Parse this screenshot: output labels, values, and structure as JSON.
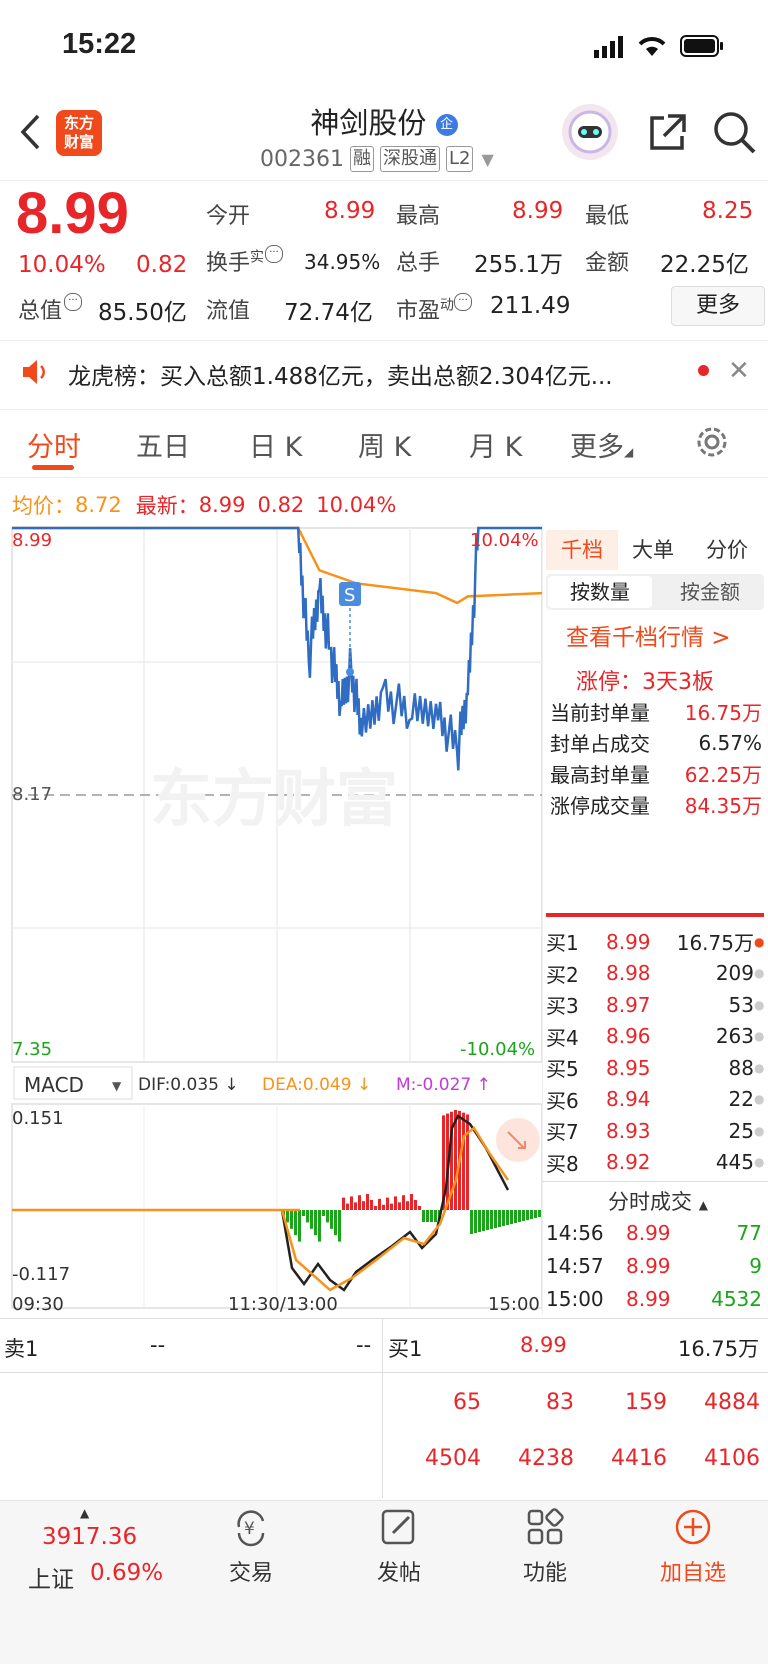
{
  "status": {
    "time": "15:22"
  },
  "header": {
    "logo_text": "东方\n财富",
    "name": "神剑股份",
    "name_badge": "企",
    "code": "002361",
    "tags": [
      "融",
      "深股通",
      "L2"
    ]
  },
  "quote": {
    "price": "8.99",
    "change_pct": "10.04%",
    "change": "0.82",
    "open_label": "今开",
    "open": "8.99",
    "high_label": "最高",
    "high": "8.99",
    "low_label": "最低",
    "low": "8.25",
    "turnover_label": "换手",
    "turnover_sup": "实",
    "turnover": "34.95%",
    "volume_label": "总手",
    "volume": "255.1万",
    "amount_label": "金额",
    "amount": "22.25亿",
    "mktcap_label": "总值",
    "mktcap": "85.50亿",
    "float_label": "流值",
    "float": "72.74亿",
    "pe_label": "市盈",
    "pe_sup": "动",
    "pe": "211.49",
    "more_label": "更多"
  },
  "notice": {
    "text": "龙虎榜：买入总额1.488亿元，卖出总额2.304亿元..."
  },
  "tabs": [
    "分时",
    "五日",
    "日 K",
    "周 K",
    "月 K",
    "更多"
  ],
  "active_tab": "分时",
  "legend_line": {
    "avg_label": "均价：",
    "avg": "8.72",
    "last_label": "最新：",
    "last": "8.99",
    "chg": "0.82",
    "pct": "10.04%"
  },
  "chart_labels": {
    "y_top": "8.99",
    "y_mid": "8.17",
    "y_bot": "7.35",
    "pct_top": "10.04%",
    "pct_bot": "-10.04%",
    "watermark": "东方财富",
    "marker": "S",
    "macd_name": "MACD",
    "dif": "DIF:0.035 ↓",
    "dea": "DEA:0.049 ↓",
    "m": "M:-0.027 ↑",
    "macd_top": "0.151",
    "macd_bot": "-0.117",
    "t0": "09:30",
    "t1": "11:30/13:00",
    "t2": "15:00"
  },
  "colors": {
    "up": "#e8262a",
    "down": "#1aa51a",
    "avg": "#f7931a",
    "price": "#2f6cc2",
    "accent": "#f04a1c"
  },
  "chart_data": {
    "type": "line",
    "x": [
      "09:30",
      "11:30/13:00",
      "15:00"
    ],
    "ylim": [
      7.35,
      8.99
    ],
    "prev_close": 8.17,
    "series": [
      {
        "points": [
          [
            0,
            8.99
          ],
          [
            0.54,
            8.99
          ],
          [
            0.56,
            8.58
          ],
          [
            0.58,
            8.8
          ],
          [
            0.6,
            8.62
          ],
          [
            0.62,
            8.45
          ],
          [
            0.64,
            8.56
          ],
          [
            0.66,
            8.35
          ],
          [
            0.7,
            8.5
          ],
          [
            0.75,
            8.4
          ],
          [
            0.8,
            8.45
          ],
          [
            0.84,
            8.3
          ],
          [
            0.86,
            8.48
          ],
          [
            0.88,
            8.99
          ],
          [
            1.0,
            8.99
          ]
        ]
      },
      {
        "points": [
          [
            0,
            8.99
          ],
          [
            0.54,
            8.99
          ],
          [
            0.58,
            8.86
          ],
          [
            0.65,
            8.82
          ],
          [
            0.8,
            8.79
          ],
          [
            0.84,
            8.76
          ],
          [
            0.86,
            8.78
          ],
          [
            1.0,
            8.79
          ]
        ]
      }
    ]
  },
  "side": {
    "tabs": [
      "千档",
      "大单",
      "分价"
    ],
    "sub_tabs": [
      "按数量",
      "按金额"
    ],
    "link": "查看千档行情 >",
    "limit_title": "涨停：3天3板",
    "stats": [
      {
        "label": "当前封单量",
        "value": "16.75万"
      },
      {
        "label": "封单占成交",
        "value": "6.57%"
      },
      {
        "label": "最高封单量",
        "value": "62.25万"
      },
      {
        "label": "涨停成交量",
        "value": "84.35万"
      }
    ],
    "bids": [
      {
        "label": "买1",
        "price": "8.99",
        "vol": "16.75万"
      },
      {
        "label": "买2",
        "price": "8.98",
        "vol": "209"
      },
      {
        "label": "买3",
        "price": "8.97",
        "vol": "53"
      },
      {
        "label": "买4",
        "price": "8.96",
        "vol": "263"
      },
      {
        "label": "买5",
        "price": "8.95",
        "vol": "88"
      },
      {
        "label": "买6",
        "price": "8.94",
        "vol": "22"
      },
      {
        "label": "买7",
        "price": "8.93",
        "vol": "25"
      },
      {
        "label": "买8",
        "price": "8.92",
        "vol": "445"
      }
    ],
    "trades_title": "分时成交",
    "trades": [
      {
        "time": "14:56",
        "price": "8.99",
        "vol": "77"
      },
      {
        "time": "14:57",
        "price": "8.99",
        "vol": "9"
      },
      {
        "time": "15:00",
        "price": "8.99",
        "vol": "4532"
      }
    ]
  },
  "order_book": {
    "sell_label": "卖1",
    "sell_price": "--",
    "sell_vol": "--",
    "buy_label": "买1",
    "buy_price": "8.99",
    "buy_vol": "16.75万",
    "row1": [
      "65",
      "83",
      "159",
      "4884"
    ],
    "row2": [
      "4504",
      "4238",
      "4416",
      "4106"
    ]
  },
  "bottom": {
    "index_value": "3917.36",
    "index_name": "上证",
    "index_pct": "0.69%",
    "items": [
      "交易",
      "发帖",
      "功能",
      "加自选"
    ]
  }
}
